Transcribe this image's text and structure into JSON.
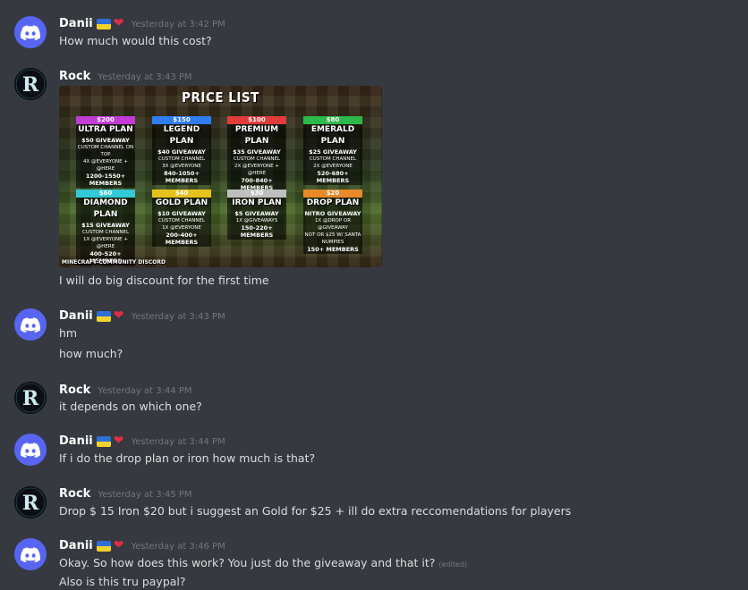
{
  "messages": [
    {
      "user": "Danii",
      "time": "Yesterday at 3:42 PM",
      "lines": [
        "How much would this cost?"
      ]
    },
    {
      "user": "Rock",
      "time": "Yesterday at 3:43 PM",
      "lines": [
        "I will do big discount for the first time"
      ]
    },
    {
      "user": "Danii",
      "time": "Yesterday at 3:43 PM",
      "lines": [
        "hm",
        "how much?"
      ]
    },
    {
      "user": "Rock",
      "time": "Yesterday at 3:44 PM",
      "lines": [
        "it depends on which one?"
      ]
    },
    {
      "user": "Danii",
      "time": "Yesterday at 3:44 PM",
      "lines": [
        "If i do the drop plan or iron how much is that?"
      ]
    },
    {
      "user": "Rock",
      "time": "Yesterday at 3:45 PM",
      "lines": [
        "Drop $ 15 Iron $20 but i suggest an Gold for $25 + ill do extra reccomendations for players"
      ]
    },
    {
      "user": "Danii",
      "time": "Yesterday at 3:46 PM",
      "lines": [
        "Okay. So how does this work? You just do the giveaway and that it?",
        "Also is this tru paypal?"
      ],
      "edited": "(edited)"
    }
  ],
  "price_list": {
    "title": "PRICE LIST",
    "footer": "MINECRAFT COMMUNITY DISCORD",
    "plans": [
      {
        "price": "$200",
        "name": "ULTRA PLAN",
        "color": "#c23bd4",
        "giveaway": "$50 GIVEAWAY",
        "l1": "CUSTOM CHANNEL ON TOP",
        "l2": "4X @EVERYONE + @HERE",
        "members": "1200-1550+ MEMBERS"
      },
      {
        "price": "$150",
        "name": "LEGEND PLAN",
        "color": "#2f7df0",
        "giveaway": "$40 GIVEAWAY",
        "l1": "CUSTOM CHANNEL",
        "l2": "3X @EVERYONE",
        "members": "840-1050+ MEMBERS"
      },
      {
        "price": "$100",
        "name": "PREMIUM PLAN",
        "color": "#e23b3b",
        "giveaway": "$35 GIVEAWAY",
        "l1": "CUSTOM CHANNEL",
        "l2": "2X @EVERYONE + @HERE",
        "members": "700-840+ MEMBERS"
      },
      {
        "price": "$80",
        "name": "EMERALD PLAN",
        "color": "#2db84b",
        "giveaway": "$25 GIVEAWAY",
        "l1": "CUSTOM CHANNEL",
        "l2": "2X @EVERYONE",
        "members": "520-680+ MEMBERS"
      },
      {
        "price": "$60",
        "name": "DIAMOND PLAN",
        "color": "#33c9d6",
        "giveaway": "$15 GIVEAWAY",
        "l1": "CUSTOM CHANNEL",
        "l2": "1X @EVERYONE + @HERE",
        "members": "400-520+ MEMBERS"
      },
      {
        "price": "$40",
        "name": "GOLD PLAN",
        "color": "#e6c21d",
        "giveaway": "$10 GIVEAWAY",
        "l1": "CUSTOM CHANNEL",
        "l2": "1X @EVERYONE",
        "members": "200-400+ MEMBERS"
      },
      {
        "price": "$30",
        "name": "IRON PLAN",
        "color": "#bfbfbf",
        "giveaway": "$5 GIVEAWAY",
        "l1": "1X @GIVEAWAYS",
        "l2": "",
        "members": "150-220+ MEMBERS"
      },
      {
        "price": "$20",
        "name": "DROP PLAN",
        "color": "#e8892a",
        "giveaway": "NITRO GIVEAWAY",
        "l1": "1X @DROP OR @GIVEAWAY",
        "l2": "NOT OR $25 W/ SANTA NUMPIES",
        "members": "150+ MEMBERS"
      }
    ]
  }
}
